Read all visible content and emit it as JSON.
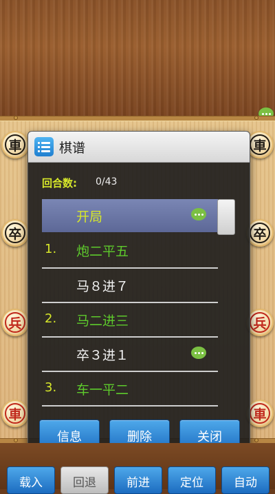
{
  "board": {
    "left_pieces": [
      {
        "text": "車",
        "color": "black"
      },
      {
        "text": "卒",
        "color": "black"
      },
      {
        "text": "兵",
        "color": "red"
      },
      {
        "text": "車",
        "color": "red"
      }
    ],
    "right_pieces": [
      {
        "text": "車",
        "color": "black"
      },
      {
        "text": "卒",
        "color": "black"
      },
      {
        "text": "兵",
        "color": "red"
      },
      {
        "text": "車",
        "color": "red"
      }
    ]
  },
  "dialog": {
    "title": "棋谱",
    "round_label": "回合数:",
    "round_value": "0/43",
    "moves": [
      {
        "num": "",
        "text": "开局",
        "color": "yellow",
        "selected": true,
        "comment": true
      },
      {
        "num": "1.",
        "text": "炮二平五",
        "color": "green",
        "selected": false,
        "comment": false
      },
      {
        "num": "",
        "text": "马８进７",
        "color": "white",
        "selected": false,
        "comment": false
      },
      {
        "num": "2.",
        "text": "马二进三",
        "color": "green",
        "selected": false,
        "comment": false
      },
      {
        "num": "",
        "text": "卒３进１",
        "color": "white",
        "selected": false,
        "comment": true
      },
      {
        "num": "3.",
        "text": "车一平二",
        "color": "green",
        "selected": false,
        "comment": false
      }
    ],
    "buttons": {
      "info": "信息",
      "delete": "删除",
      "close": "关闭"
    }
  },
  "toolbar": {
    "load": "载入",
    "undo": "回退",
    "forward": "前进",
    "locate": "定位",
    "auto": "自动"
  },
  "colors": {
    "accent": "#1c6cc0",
    "move_green": "#5ecb2c",
    "highlight": "#d7e82a",
    "red_piece": "#c0271b"
  }
}
